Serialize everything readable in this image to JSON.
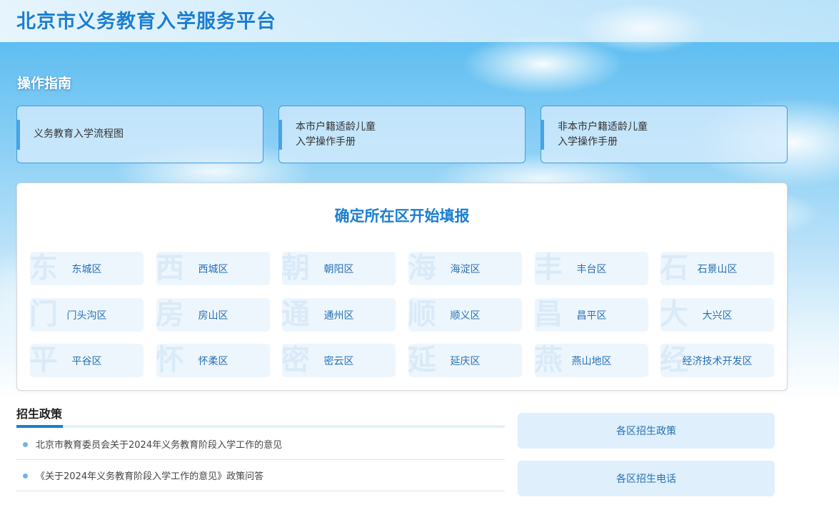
{
  "header": {
    "title": "北京市义务教育入学服务平台"
  },
  "guide": {
    "title": "操作指南",
    "cards": [
      {
        "label": "义务教育入学流程图"
      },
      {
        "label": "本市户籍适龄儿童\n入学操作手册"
      },
      {
        "label": "非本市户籍适龄儿童\n入学操作手册"
      }
    ]
  },
  "districts": {
    "heading": "确定所在区开始填报",
    "items": [
      {
        "label": "东城区",
        "mark": "东"
      },
      {
        "label": "西城区",
        "mark": "西"
      },
      {
        "label": "朝阳区",
        "mark": "朝"
      },
      {
        "label": "海淀区",
        "mark": "海"
      },
      {
        "label": "丰台区",
        "mark": "丰"
      },
      {
        "label": "石景山区",
        "mark": "石"
      },
      {
        "label": "门头沟区",
        "mark": "门"
      },
      {
        "label": "房山区",
        "mark": "房"
      },
      {
        "label": "通州区",
        "mark": "通"
      },
      {
        "label": "顺义区",
        "mark": "顺"
      },
      {
        "label": "昌平区",
        "mark": "昌"
      },
      {
        "label": "大兴区",
        "mark": "大"
      },
      {
        "label": "平谷区",
        "mark": "平"
      },
      {
        "label": "怀柔区",
        "mark": "怀"
      },
      {
        "label": "密云区",
        "mark": "密"
      },
      {
        "label": "延庆区",
        "mark": "延"
      },
      {
        "label": "燕山地区",
        "mark": "燕"
      },
      {
        "label": "经济技术开发区",
        "mark": "经"
      }
    ]
  },
  "policy": {
    "title": "招生政策",
    "items": [
      {
        "text": "北京市教育委员会关于2024年义务教育阶段入学工作的意见"
      },
      {
        "text": "《关于2024年义务教育阶段入学工作的意见》政策问答"
      }
    ]
  },
  "side_links": [
    {
      "label": "各区招生政策"
    },
    {
      "label": "各区招生电话"
    }
  ],
  "colors": {
    "accent": "#1a7ed1",
    "link": "#2470b5",
    "card_border": "#3b9de4"
  }
}
